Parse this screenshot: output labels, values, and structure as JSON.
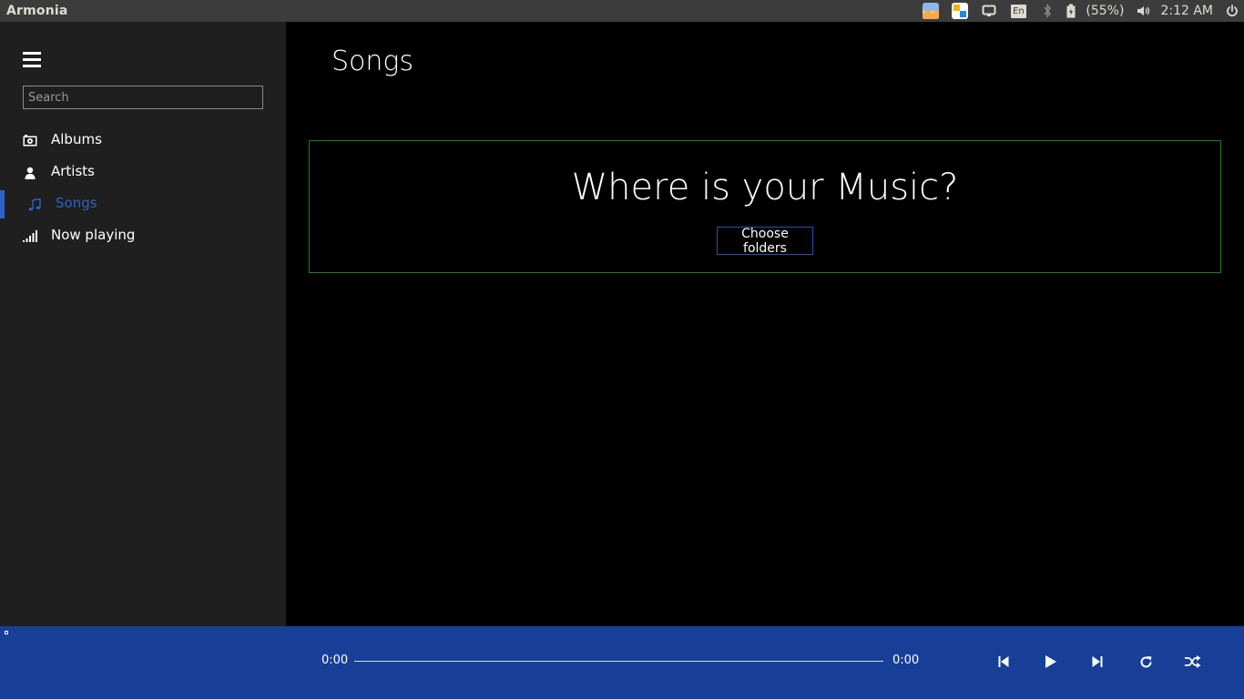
{
  "system_bar": {
    "app_title": "Armonia",
    "keyboard_layout": "En",
    "battery_percent": "(55%)",
    "clock": "2:12 AM",
    "icons": [
      "image-viewer-icon",
      "windows-app-icon",
      "display-icon",
      "keyboard-layout-icon",
      "bluetooth-icon",
      "battery-icon",
      "volume-icon",
      "power-icon"
    ]
  },
  "sidebar": {
    "search": {
      "placeholder": "Search",
      "value": ""
    },
    "items": [
      {
        "label": "Albums",
        "icon": "album-icon",
        "active": false
      },
      {
        "label": "Artists",
        "icon": "person-icon",
        "active": false
      },
      {
        "label": "Songs",
        "icon": "music-note-icon",
        "active": true
      },
      {
        "label": "Now playing",
        "icon": "signal-bars-icon",
        "active": false
      }
    ]
  },
  "main": {
    "title": "Songs",
    "empty_state": {
      "heading": "Where is your Music?",
      "button_label": "Choose folders"
    }
  },
  "player": {
    "current_time": "0:00",
    "total_time": "0:00",
    "progress": 0,
    "controls": [
      "previous-icon",
      "play-icon",
      "next-icon",
      "repeat-icon",
      "shuffle-icon"
    ]
  },
  "colors": {
    "accent": "#2d62c9",
    "player_bar": "#173f97",
    "sidebar_bg": "#1f1f1f",
    "empty_box_border": "#1f7d1f",
    "top_bar": "#3c3c3c"
  }
}
